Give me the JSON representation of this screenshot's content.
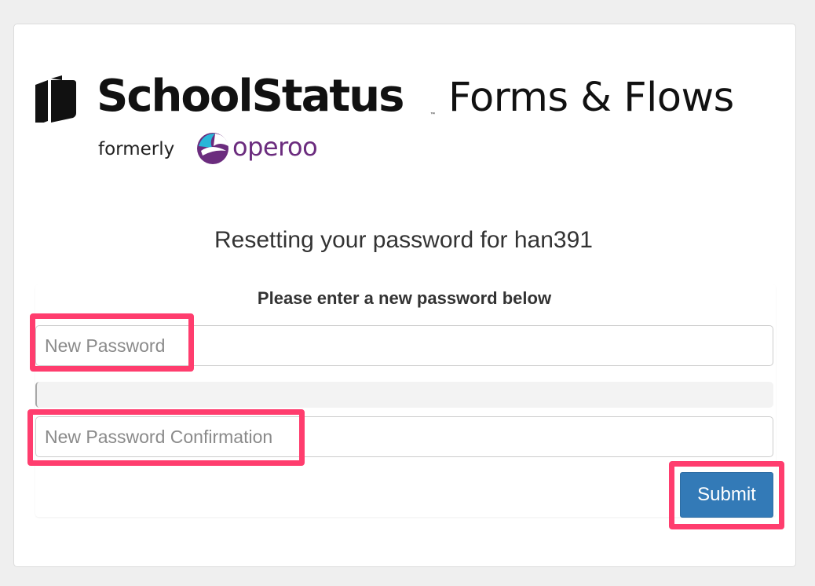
{
  "branding": {
    "brand_name": "SchoolStatus",
    "trademark": "™",
    "product_name": "Forms & Flows",
    "formerly_label": "formerly",
    "former_brand": "operoo"
  },
  "page": {
    "title": "Resetting your password for han391"
  },
  "form": {
    "subtitle": "Please enter a new password below",
    "new_password_placeholder": "New Password",
    "new_password_value": "",
    "confirmation_placeholder": "New Password Confirmation",
    "confirmation_value": "",
    "submit_label": "Submit"
  },
  "colors": {
    "accent": "#337ab7",
    "highlight": "#ff3d6e",
    "operoo_purple": "#6b2c7e",
    "operoo_cyan": "#29b6d8"
  }
}
